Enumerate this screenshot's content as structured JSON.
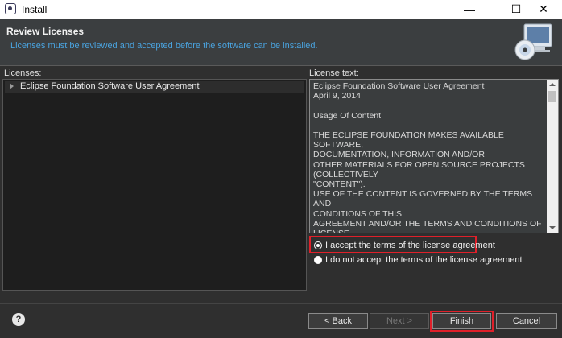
{
  "window": {
    "title": "Install",
    "minimize_glyph": "—",
    "maximize_glyph": "☐",
    "close_glyph": "✕"
  },
  "header": {
    "title": "Review Licenses",
    "description": "Licenses must be reviewed and accepted before the software can be installed.",
    "icon": "cd-install-icon"
  },
  "licenses": {
    "label": "Licenses:",
    "items": [
      {
        "label": "Eclipse Foundation Software User Agreement"
      }
    ]
  },
  "license_text": {
    "label": "License text:",
    "content": "Eclipse Foundation Software User Agreement\nApril 9, 2014\n\nUsage Of Content\n\nTHE ECLIPSE FOUNDATION MAKES AVAILABLE SOFTWARE,\nDOCUMENTATION, INFORMATION AND/OR\nOTHER MATERIALS FOR OPEN SOURCE PROJECTS (COLLECTIVELY\n\"CONTENT\").\nUSE OF THE CONTENT IS GOVERNED BY THE TERMS AND\nCONDITIONS OF THIS\nAGREEMENT AND/OR THE TERMS AND CONDITIONS OF LICENSE\nAGREEMENTS OR\nNOTICES INDICATED OR REFERENCED BELOW.  BY USING THE\nCONTENT, YOU\nAGREE THAT YOUR USE OF THE CONTENT IS GOVERNED BY THIS"
  },
  "options": {
    "accept": {
      "label": "I accept the terms of the license agreement",
      "selected": true
    },
    "decline": {
      "label": "I do not accept the terms of the license agreement",
      "selected": false
    }
  },
  "buttons": {
    "help": "?",
    "back": "< Back",
    "next": "Next >",
    "finish": "Finish",
    "cancel": "Cancel"
  },
  "colors": {
    "highlight": "#e0202a",
    "accent_text": "#4aa3df",
    "background": "#2f2f2f"
  }
}
